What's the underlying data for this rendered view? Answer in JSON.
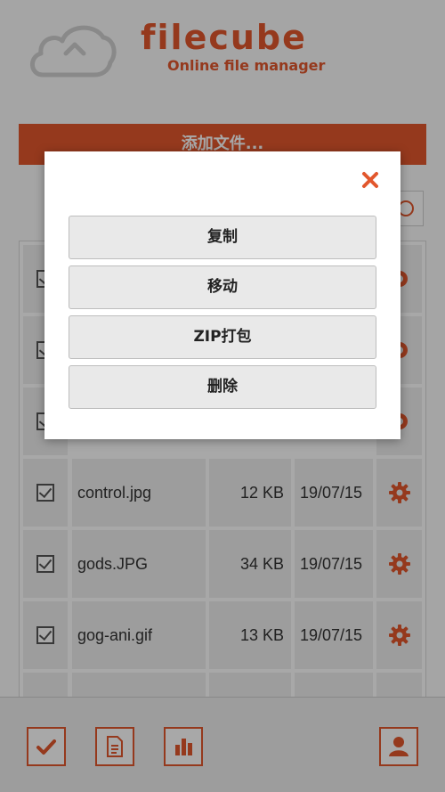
{
  "header": {
    "brand_name": "filecube",
    "tagline": "Online file manager"
  },
  "toolbar": {
    "add_files_label": "添加文件..."
  },
  "files": [
    {
      "name": "control.jpg",
      "size": "12 KB",
      "date": "19/07/15",
      "checked": true
    },
    {
      "name": "gods.JPG",
      "size": "34 KB",
      "date": "19/07/15",
      "checked": true
    },
    {
      "name": "gog-ani.gif",
      "size": "13 KB",
      "date": "19/07/15",
      "checked": true
    }
  ],
  "bottom_bar": {
    "buttons": [
      "check-icon",
      "document-icon",
      "bar-chart-icon",
      "user-icon"
    ]
  },
  "modal": {
    "actions": [
      {
        "label": "复制"
      },
      {
        "label": "移动"
      },
      {
        "label": "ZIP打包"
      },
      {
        "label": "删除"
      }
    ]
  },
  "colors": {
    "accent": "#e2572d",
    "overlay": "rgba(0,0,0,0.34)"
  }
}
